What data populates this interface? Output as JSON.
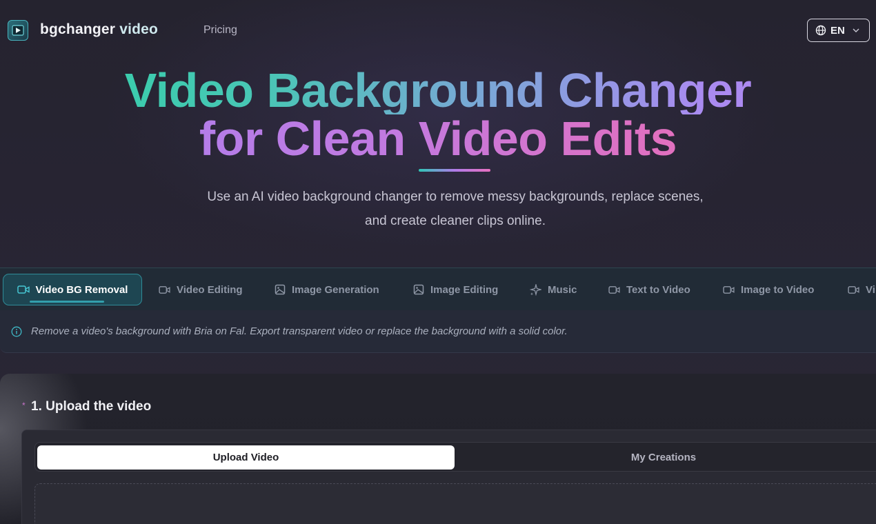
{
  "header": {
    "brand_part1": "bgchanger",
    "brand_part2": "video",
    "nav_pricing": "Pricing",
    "language": "EN"
  },
  "hero": {
    "title_line1_a": "Video Background Changer",
    "title_line2_a": "for Clean Video Edits",
    "subtitle": "Use an AI video background changer to remove messy backgrounds, replace scenes, and create cleaner clips online."
  },
  "tabs": [
    {
      "label": "Video BG Removal",
      "icon": "video-camera-icon",
      "active": true
    },
    {
      "label": "Video Editing",
      "icon": "video-camera-icon",
      "active": false
    },
    {
      "label": "Image Generation",
      "icon": "image-icon",
      "active": false
    },
    {
      "label": "Image Editing",
      "icon": "image-icon",
      "active": false
    },
    {
      "label": "Music",
      "icon": "sparkles-icon",
      "active": false
    },
    {
      "label": "Text to Video",
      "icon": "video-camera-icon",
      "active": false
    },
    {
      "label": "Image to Video",
      "icon": "video-camera-icon",
      "active": false
    },
    {
      "label": "Vi",
      "icon": "video-camera-icon",
      "active": false
    }
  ],
  "info": {
    "text": "Remove a video's background with Bria on Fal. Export transparent video or replace the background with a solid color."
  },
  "upload_section": {
    "required_marker": "*",
    "step_title": "1. Upload the video",
    "segment_upload": "Upload Video",
    "segment_creations": "My Creations"
  },
  "colors": {
    "accent_teal": "#2fd1a6",
    "accent_purple": "#a680f2",
    "accent_pink": "#ee6bb6",
    "active_tab_bg": "#1e4652"
  }
}
